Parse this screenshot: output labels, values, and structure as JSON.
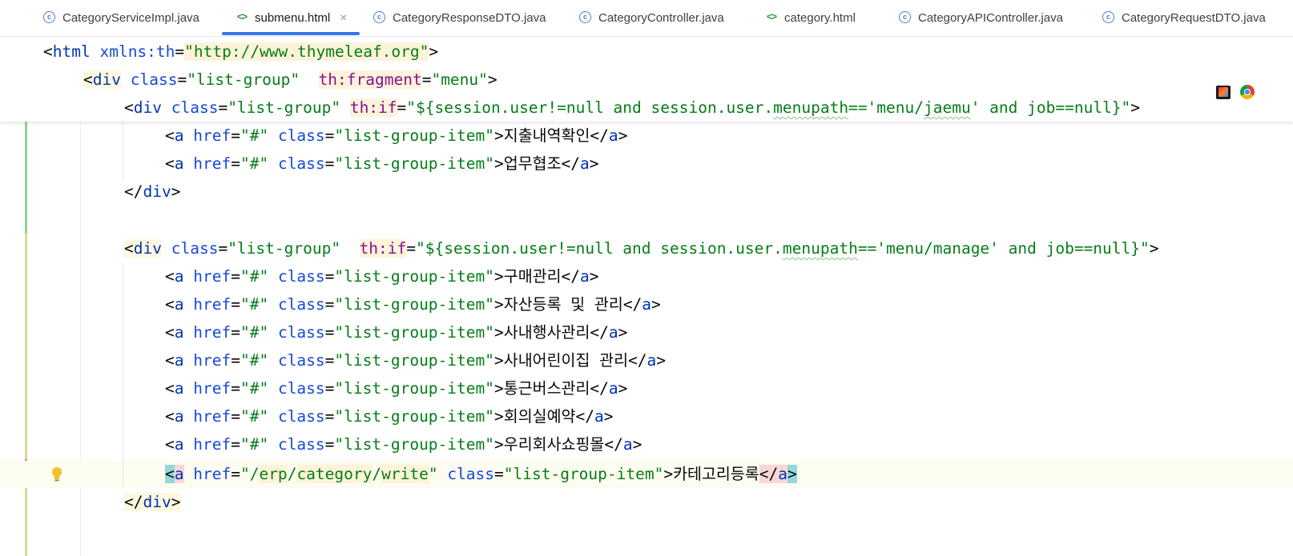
{
  "tabs": [
    {
      "label": "CategoryServiceImpl.java",
      "icon": "java-class-icon",
      "active": false
    },
    {
      "label": "submenu.html",
      "icon": "html-file-icon",
      "active": true
    },
    {
      "label": "CategoryResponseDTO.java",
      "icon": "java-class-icon",
      "active": false
    },
    {
      "label": "CategoryController.java",
      "icon": "java-class-icon",
      "active": false
    },
    {
      "label": "category.html",
      "icon": "html-file-icon",
      "active": false
    },
    {
      "label": "CategoryAPIController.java",
      "icon": "java-class-icon",
      "active": false
    },
    {
      "label": "CategoryRequestDTO.java",
      "icon": "java-class-icon",
      "active": false
    }
  ],
  "tab_close_glyph": "×",
  "colors": {
    "accent": "#3574f0",
    "tag": "#0033b3",
    "attribute": "#174ad4",
    "namespace": "#871094",
    "string": "#067d17",
    "vcs_added": "#8fd18f",
    "vcs_modified": "#d9d99a",
    "vcs_deleted": "#e48d8d"
  },
  "code": {
    "line1": {
      "open": "<",
      "tag": "html",
      "attr": "xmlns:th",
      "eq": "=",
      "val": "\"http://www.thymeleaf.org\"",
      "close": ">"
    },
    "line2": {
      "open": "<",
      "tag": "div",
      "attr": "class",
      "eq": "=",
      "val": "\"list-group\"",
      "ns": "th:fragment",
      "eq2": "=",
      "val2": "\"menu\"",
      "close": ">"
    },
    "line3": {
      "open": "<",
      "tag": "div",
      "attr": "class",
      "eq": "=",
      "val": "\"list-group\"",
      "ns": "th:if",
      "eq2": "=",
      "val2a": "\"${session.user!=null and session.user.",
      "val2b": "menupath",
      "val2c": "=='menu/",
      "val2d": "jaemu",
      "val2e": "' and job==null}\"",
      "close": ">"
    },
    "jaemu_items": [
      "지출내역확인",
      "업무협조"
    ],
    "close_div": {
      "open": "</",
      "tag": "div",
      "close": ">"
    },
    "line7": {
      "open": "<",
      "tag": "div",
      "attr": "class",
      "eq": "=",
      "val": "\"list-group\"",
      "ns": "th:if",
      "eq2": "=",
      "val2a": "\"${session.user!=null and session.user.",
      "val2b": "menupath",
      "val2c": "=='menu/manage' and job==null}\"",
      "close": ">"
    },
    "item_prefix": {
      "open": "<",
      "tag": "a",
      "href_attr": "href",
      "eq": "=",
      "href_val": "\"#\"",
      "class_attr": "class",
      "class_val": "\"list-group-item\"",
      "close": ">",
      "end_open": "</",
      "end_close": ">"
    },
    "manage_items": [
      "구매관리",
      "자산등록 및 관리",
      "사내행사관리",
      "사내어린이집 관리",
      "통근버스관리",
      "회의실예약",
      "우리회사쇼핑몰"
    ],
    "last_item": {
      "href_q1": "\"/",
      "href_p1": "erp",
      "href_s1": "/",
      "href_p2": "category",
      "href_s2": "/",
      "href_p3": "write",
      "href_q2": "\"",
      "label": "카테고리등록"
    }
  }
}
